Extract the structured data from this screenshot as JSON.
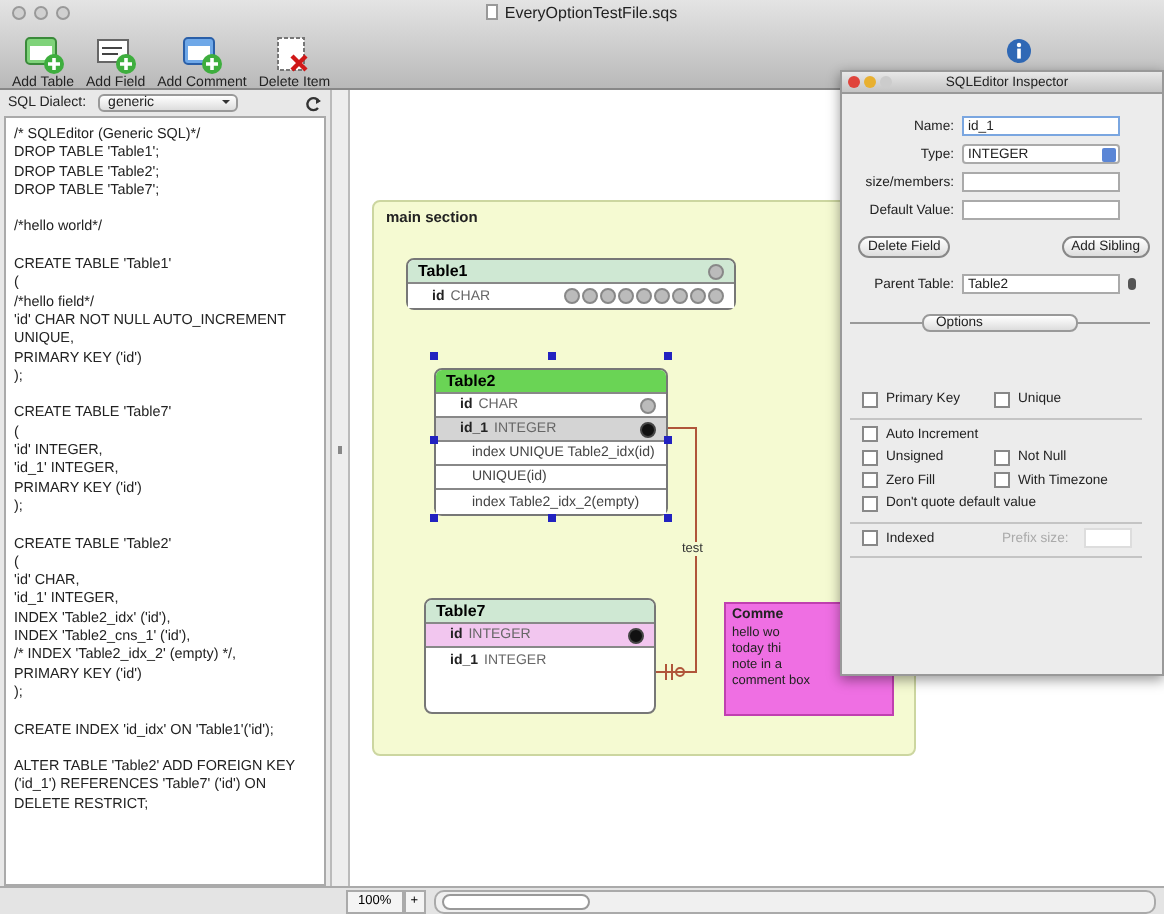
{
  "window": {
    "title": "EveryOptionTestFile.sqs"
  },
  "toolbar": [
    {
      "label": "Add Table",
      "kind": "add_table"
    },
    {
      "label": "Add Field",
      "kind": "add_field"
    },
    {
      "label": "Add Comment",
      "kind": "add_comment"
    },
    {
      "label": "Delete Item",
      "kind": "delete"
    }
  ],
  "sql_pane": {
    "dialect_label": "SQL Dialect:",
    "dialect": "generic",
    "statements": [
      [
        "/* SQLEditor (Generic SQL)*/",
        "DROP TABLE 'Table1';",
        "DROP TABLE 'Table2';",
        "DROP TABLE 'Table7';"
      ],
      [
        "/*hello world*/"
      ],
      [
        "CREATE TABLE 'Table1'",
        "(",
        "/*hello field*/",
        "'id' CHAR NOT NULL AUTO_INCREMENT",
        "UNIQUE,",
        "PRIMARY KEY ('id')",
        ");"
      ],
      [
        "CREATE TABLE 'Table7'",
        "(",
        "'id' INTEGER,",
        "'id_1' INTEGER,",
        "PRIMARY KEY ('id')",
        ");"
      ],
      [
        "CREATE TABLE 'Table2'",
        "(",
        "'id' CHAR,",
        "'id_1' INTEGER,",
        "INDEX 'Table2_idx' ('id'),",
        "INDEX 'Table2_cns_1' ('id'),",
        "/* INDEX 'Table2_idx_2' (empty) */,",
        "PRIMARY KEY ('id')",
        ");"
      ],
      [
        "CREATE INDEX 'id_idx' ON 'Table1'('id');"
      ],
      [
        "ALTER TABLE 'Table2' ADD FOREIGN KEY",
        "('id_1') REFERENCES 'Table7' ('id') ON",
        "DELETE RESTRICT;"
      ]
    ]
  },
  "diagram": {
    "section": {
      "title": "main section"
    },
    "tables": [
      {
        "name": "Table1",
        "selected": false,
        "help_icon": true,
        "fields": [
          {
            "kind": "column",
            "name": "id",
            "type": "CHAR",
            "selected": false,
            "related": false,
            "linked": false,
            "help_icon": false,
            "show_options": true
          }
        ]
      },
      {
        "name": "Table2",
        "selected": true,
        "help_icon": false,
        "fields": [
          {
            "kind": "column",
            "name": "id",
            "type": "CHAR",
            "selected": false,
            "related": false,
            "linked": false,
            "help_icon": true,
            "show_options": false
          },
          {
            "kind": "column",
            "name": "id_1",
            "type": "INTEGER",
            "selected": true,
            "related": false,
            "linked": true,
            "help_icon": false,
            "show_options": false
          },
          {
            "kind": "index",
            "text": "index UNIQUE Table2_idx(id)",
            "selected": false,
            "related": false,
            "linked": false,
            "help_icon": false,
            "show_options": false
          },
          {
            "kind": "index",
            "text": "UNIQUE(id)",
            "selected": false,
            "related": false,
            "linked": false,
            "help_icon": false,
            "show_options": false
          },
          {
            "kind": "index",
            "text": "index Table2_idx_2(empty)",
            "selected": false,
            "related": false,
            "linked": false,
            "help_icon": false,
            "show_options": false
          }
        ]
      },
      {
        "name": "Table7",
        "selected": false,
        "help_icon": false,
        "fields": [
          {
            "kind": "column",
            "name": "id",
            "type": "INTEGER",
            "selected": false,
            "related": true,
            "linked": true,
            "help_icon": false,
            "show_options": false
          },
          {
            "kind": "column",
            "name": "id_1",
            "type": "INTEGER",
            "selected": false,
            "related": false,
            "linked": false,
            "help_icon": false,
            "show_options": false
          }
        ]
      }
    ],
    "relations": [
      {
        "label": "test"
      }
    ],
    "comment": {
      "title": "Comme",
      "lines": [
        "hello wo",
        "today thi",
        "note in a",
        "comment box"
      ]
    }
  },
  "zoom": {
    "value": "100%",
    "plus": "+"
  },
  "inspector": {
    "title": "SQLEditor Inspector",
    "name": {
      "label": "Name:",
      "value": "id_1"
    },
    "type": {
      "label": "Type:",
      "value": "INTEGER"
    },
    "size": {
      "label": "size/members:"
    },
    "default": {
      "label": "Default Value:"
    },
    "buttons": [
      "Delete Field",
      "Add Sibling"
    ],
    "parent": {
      "label": "Parent Table:",
      "value": "Table2"
    },
    "options": "Options",
    "option_groups": [
      [
        [
          {
            "label": "Primary Key",
            "checked": false
          },
          {
            "label": "Unique",
            "checked": false
          }
        ]
      ],
      [
        [
          {
            "label": "Auto Increment",
            "checked": false
          }
        ],
        [
          {
            "label": "Unsigned",
            "checked": false
          },
          {
            "label": "Not Null",
            "checked": false
          }
        ],
        [
          {
            "label": "Zero Fill",
            "checked": false
          },
          {
            "label": "With Timezone",
            "checked": false
          }
        ],
        [
          {
            "label": "Don't quote default value",
            "checked": false
          }
        ]
      ]
    ],
    "indexed": {
      "label": "Indexed",
      "checked": false
    },
    "prefix": {
      "label": "Prefix size:",
      "disabled": true
    }
  }
}
